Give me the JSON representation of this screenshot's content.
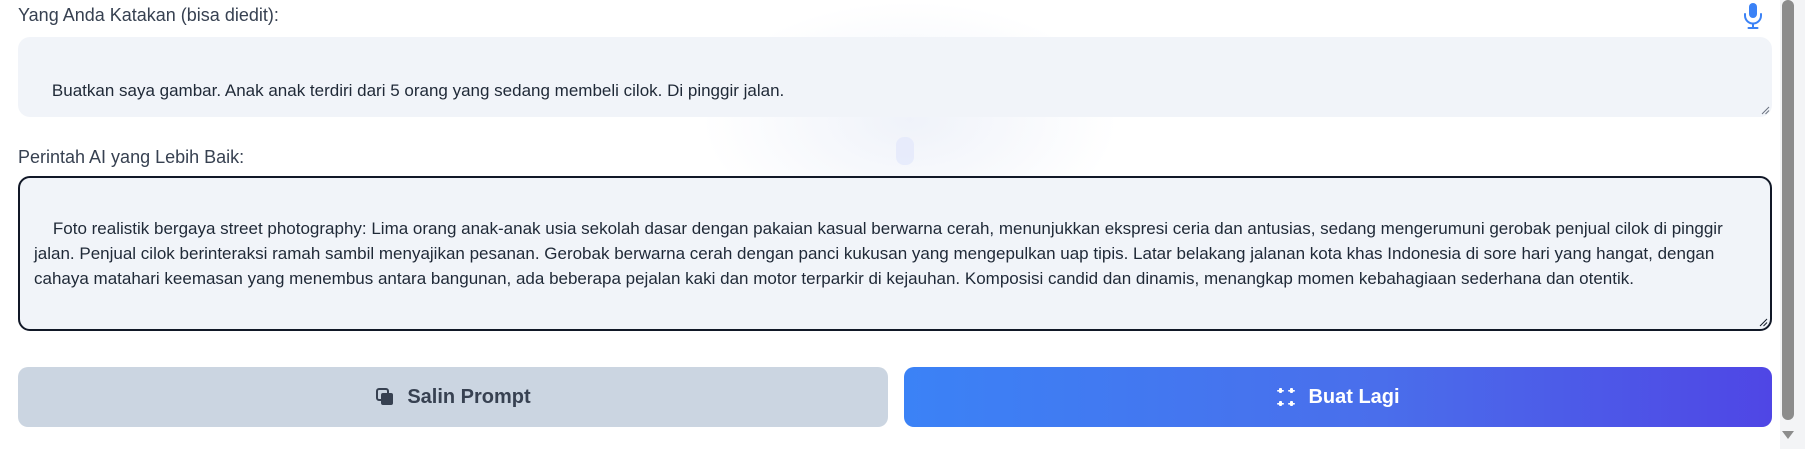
{
  "spoken": {
    "label": "Yang Anda Katakan (bisa diedit):",
    "text": "Buatkan saya gambar. Anak anak terdiri dari 5 orang yang sedang membeli cilok. Di pinggir jalan."
  },
  "improved": {
    "label": "Perintah AI yang Lebih Baik:",
    "text": "Foto realistik bergaya street photography: Lima orang anak-anak usia sekolah dasar dengan pakaian kasual berwarna cerah, menunjukkan ekspresi ceria dan antusias, sedang mengerumuni gerobak penjual cilok di pinggir jalan. Penjual cilok berinteraksi ramah sambil menyajikan pesanan. Gerobak berwarna cerah dengan panci kukusan yang mengepulkan uap tipis. Latar belakang jalanan kota khas Indonesia di sore hari yang hangat, dengan cahaya matahari keemasan yang menembus antara bangunan, ada beberapa pejalan kaki dan motor terparkir di kejauhan. Komposisi candid dan dinamis, menangkap momen kebahagiaan sederhana dan otentik."
  },
  "buttons": {
    "copy_label": "Salin Prompt",
    "regenerate_label": "Buat Lagi"
  },
  "icons": {
    "mic": "microphone-icon",
    "copy": "copy-icon",
    "regenerate": "sparkle-icon"
  },
  "colors": {
    "accent_start": "#3b82f6",
    "accent_end": "#4f46e5",
    "mic": "#3b82f6",
    "copy_button_bg": "#cbd5e1",
    "box_bg": "#f1f4f9"
  }
}
